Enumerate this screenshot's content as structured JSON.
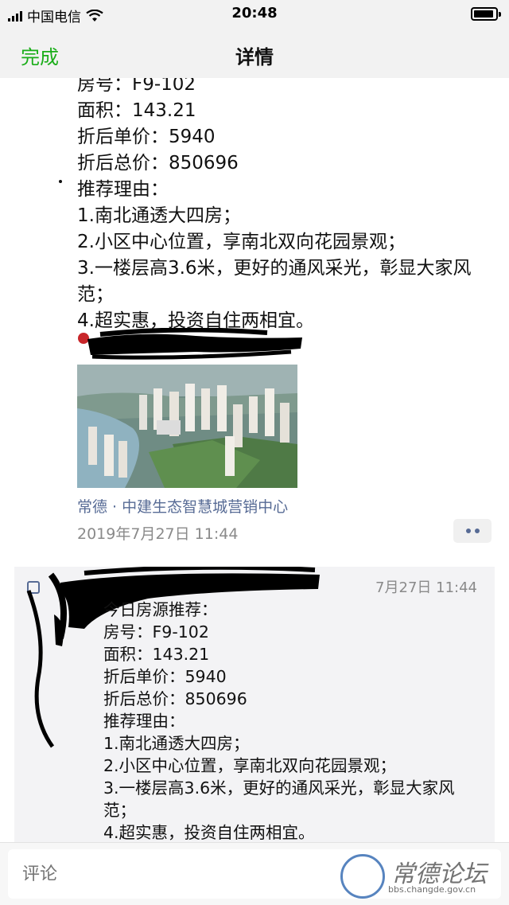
{
  "status_bar": {
    "carrier": "中国电信",
    "time": "20:48"
  },
  "nav": {
    "done_label": "完成",
    "title": "详情"
  },
  "post": {
    "lines": [
      "房号：F9-102",
      "面积：143.21",
      "折后单价：5940",
      "折后总价：850696",
      "推荐理由：",
      "1.南北通透大四房；",
      "2.小区中心位置，享南北双向花园景观；",
      "3.一楼层高3.6米，更好的通风采光，彰显大家风范；",
      "4.超实惠，投资自住两相宜。"
    ],
    "location": "常德 · 中建生态智慧城营销中心",
    "timestamp": "2019年7月27日 11:44"
  },
  "comment": {
    "time": "7月27日 11:44",
    "lines": [
      "今日房源推荐：",
      "房号：F9-102",
      "面积：143.21",
      "折后单价：5940",
      "折后总价：850696",
      "推荐理由：",
      "1.南北通透大四房；",
      "2.小区中心位置，享南北双向花园景观；",
      "3.一楼层高3.6米，更好的通风采光，彰显大家风范；",
      "4.超实惠，投资自住两相宜。"
    ]
  },
  "input": {
    "placeholder": "评论"
  },
  "watermark": {
    "title": "常德论坛",
    "url": "bbs.changde.gov.cn"
  },
  "colors": {
    "accent_green": "#1aad19",
    "link_blue": "#576b95",
    "time_gray": "#8a8a8a"
  }
}
